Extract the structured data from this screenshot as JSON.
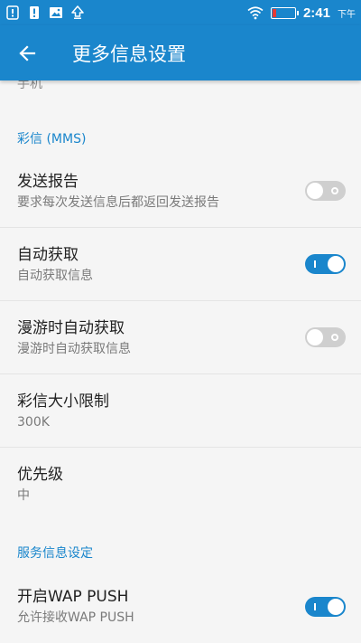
{
  "status_bar": {
    "time": "2:41",
    "ampm": "下午",
    "icons": [
      "notification-icon",
      "alert-icon",
      "image-icon",
      "upload-icon",
      "wifi-icon",
      "battery-icon"
    ],
    "battery_level": 0.15
  },
  "app_bar": {
    "title": "更多信息设置",
    "back_icon": "arrow-back-icon"
  },
  "clipped_item_text": "手机",
  "mms_section": {
    "header": "彩信 (MMS)",
    "items": [
      {
        "title": "发送报告",
        "subtitle": "要求每次发送信息后都返回发送报告",
        "toggle": false
      },
      {
        "title": "自动获取",
        "subtitle": "自动获取信息",
        "toggle": true
      },
      {
        "title": "漫游时自动获取",
        "subtitle": "漫游时自动获取信息",
        "toggle": false
      },
      {
        "title": "彩信大小限制",
        "subtitle": "300K"
      },
      {
        "title": "优先级",
        "subtitle": "中"
      }
    ]
  },
  "service_section": {
    "header": "服务信息设定",
    "items": [
      {
        "title": "开启WAP PUSH",
        "subtitle": "允许接收WAP PUSH",
        "toggle": true
      }
    ]
  },
  "colors": {
    "accent": "#1a86cc",
    "background": "#f5f5f5",
    "toggle_off": "#cfcfcf"
  }
}
